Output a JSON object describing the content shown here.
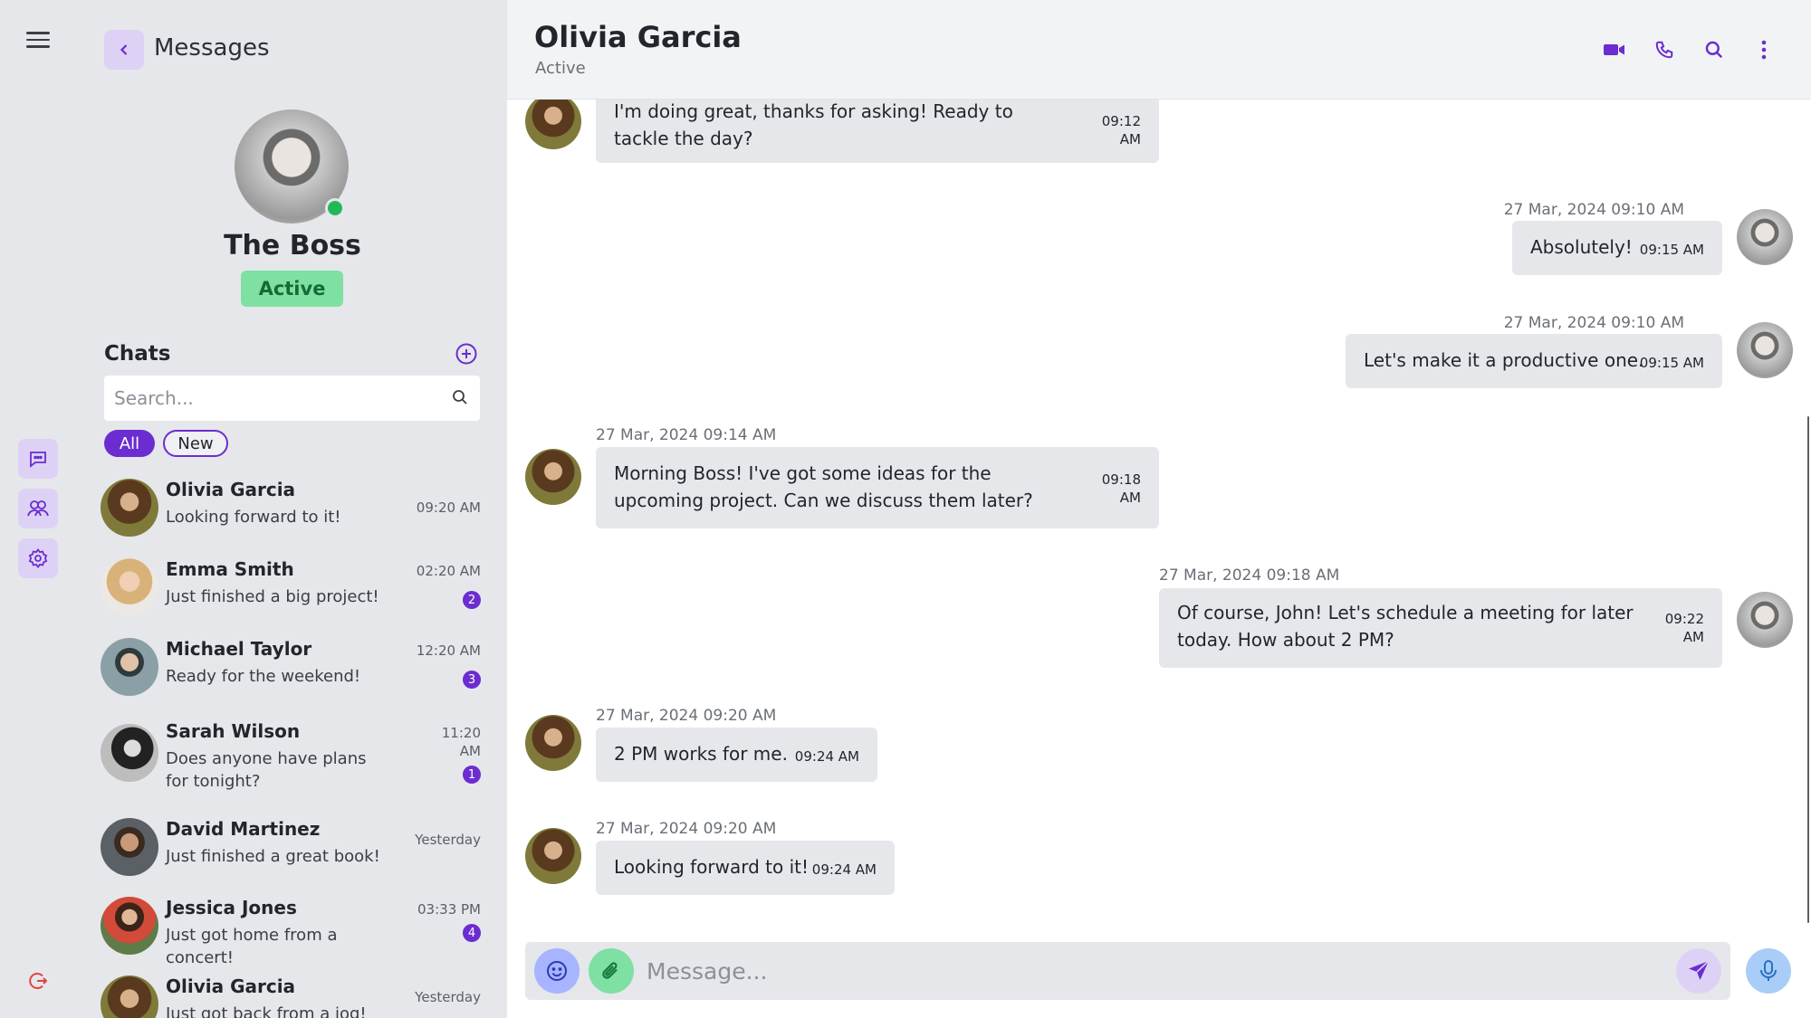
{
  "sidebar": {
    "title": "Messages",
    "profile": {
      "name": "The Boss",
      "status": "Active"
    },
    "chats_title": "Chats",
    "search_placeholder": "Search...",
    "filters": [
      "All",
      "New"
    ],
    "chats": [
      {
        "name": "Olivia Garcia",
        "preview": "Looking forward to it!",
        "time": "09:20 AM",
        "badge": ""
      },
      {
        "name": "Emma Smith",
        "preview": "Just finished a big project!",
        "time": "02:20 AM",
        "badge": "2"
      },
      {
        "name": "Michael Taylor",
        "preview": "Ready for the weekend!",
        "time": "12:20 AM",
        "badge": "3"
      },
      {
        "name": "Sarah Wilson",
        "preview": "Does anyone have plans for tonight?",
        "time": "11:20 AM",
        "badge": "1"
      },
      {
        "name": "David Martinez",
        "preview": "Just finished a great book!",
        "time": "Yesterday",
        "badge": ""
      },
      {
        "name": "Jessica Jones",
        "preview": "Just got home from a concert!",
        "time": "03:33 PM",
        "badge": "4"
      },
      {
        "name": "Olivia Garcia",
        "preview": "Just got back from a jog!",
        "time": "Yesterday",
        "badge": ""
      }
    ]
  },
  "header": {
    "name": "Olivia Garcia",
    "status": "Active"
  },
  "messages": [
    {
      "from": "them",
      "date": "",
      "text": "I'm doing great, thanks for asking! Ready to tackle the day?",
      "time": "09:12 AM"
    },
    {
      "from": "me",
      "date": "27 Mar, 2024 09:10 AM",
      "text": "Absolutely!",
      "time": "09:15 AM"
    },
    {
      "from": "me",
      "date": "27 Mar, 2024 09:10 AM",
      "text": "Let's make it a productive one.",
      "time": "09:15 AM"
    },
    {
      "from": "them",
      "date": "27 Mar, 2024 09:14 AM",
      "text": "Morning Boss! I've got some ideas for the upcoming project. Can we discuss them later?",
      "time": "09:18 AM"
    },
    {
      "from": "me",
      "date": "27 Mar, 2024 09:18 AM",
      "text": "Of course, John! Let's schedule a meeting for later today. How about 2 PM?",
      "time": "09:22 AM"
    },
    {
      "from": "them",
      "date": "27 Mar, 2024 09:20 AM",
      "text": "2 PM works for me.",
      "time": "09:24 AM"
    },
    {
      "from": "them",
      "date": "27 Mar, 2024 09:20 AM",
      "text": "Looking forward to it!",
      "time": "09:24 AM"
    }
  ],
  "composer": {
    "placeholder": "Message..."
  },
  "colors": {
    "accent": "#6b2dcf",
    "online": "#22b85a",
    "bubble": "#e6e7ea",
    "sidebar_bg": "#e6e7ea"
  }
}
